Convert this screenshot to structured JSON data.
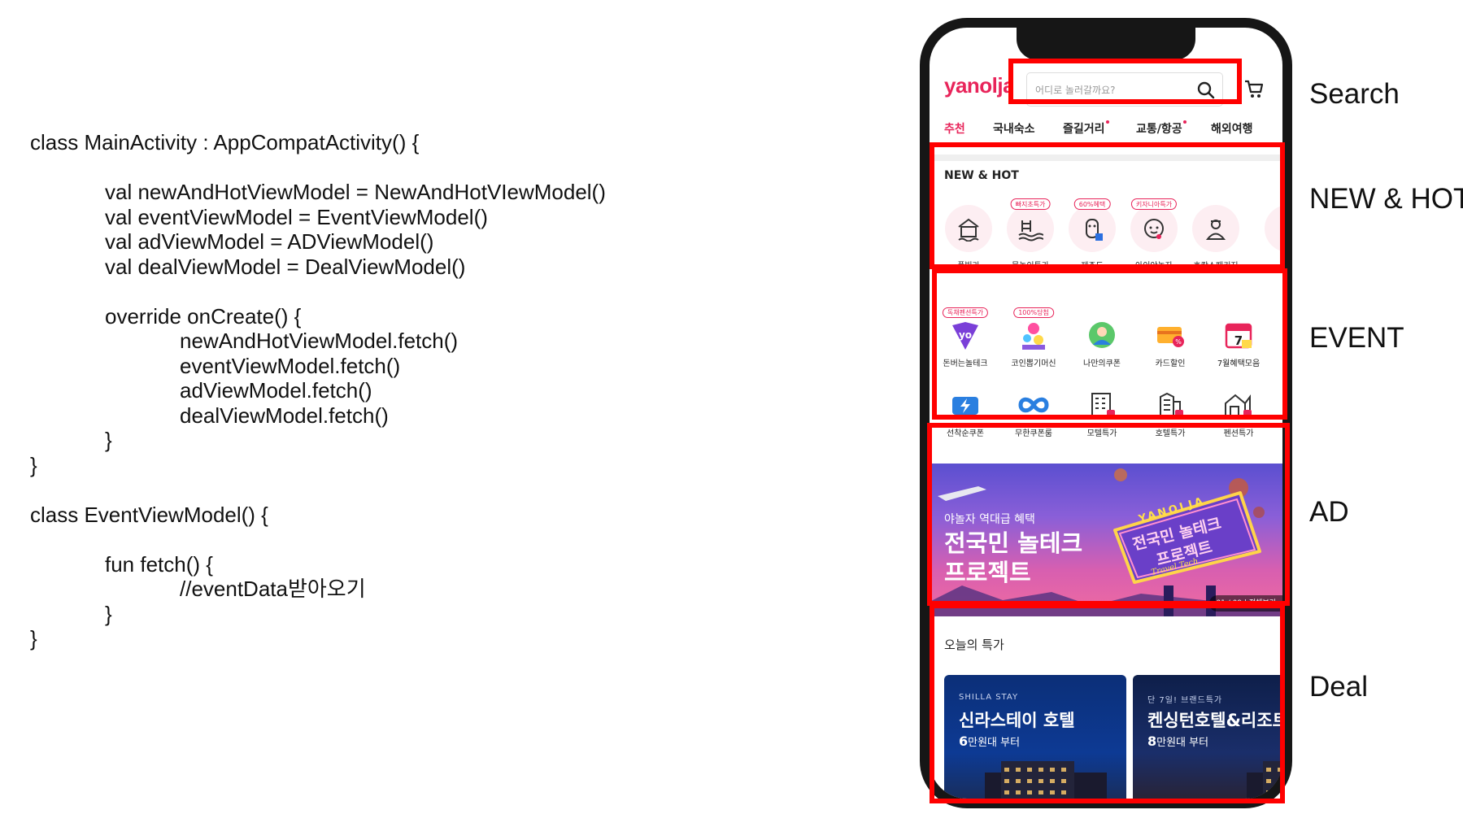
{
  "code_lines": [
    {
      "text": "class MainActivity : AppCompatActivity() {",
      "indent": 0,
      "row": 0
    },
    {
      "text": "val newAndHotViewModel = NewAndHotVIewModel()",
      "indent": 1,
      "row": 2
    },
    {
      "text": "val eventViewModel = EventViewModel()",
      "indent": 1,
      "row": 3
    },
    {
      "text": "val adViewModel = ADViewModel()",
      "indent": 1,
      "row": 4
    },
    {
      "text": "val dealViewModel = DealViewModel()",
      "indent": 1,
      "row": 5
    },
    {
      "text": "override onCreate() {",
      "indent": 1,
      "row": 7
    },
    {
      "text": "newAndHotViewModel.fetch()",
      "indent": 2,
      "row": 8
    },
    {
      "text": "eventViewModel.fetch()",
      "indent": 2,
      "row": 9
    },
    {
      "text": "adViewModel.fetch()",
      "indent": 2,
      "row": 10
    },
    {
      "text": "dealViewModel.fetch()",
      "indent": 2,
      "row": 11
    },
    {
      "text": "}",
      "indent": 1,
      "row": 12
    },
    {
      "text": "}",
      "indent": 0,
      "row": 13
    },
    {
      "text": "class EventViewModel() {",
      "indent": 0,
      "row": 15
    },
    {
      "text": "fun fetch() {",
      "indent": 1,
      "row": 17
    },
    {
      "text": "//eventData받아오기",
      "indent": 2,
      "row": 18
    },
    {
      "text": "}",
      "indent": 1,
      "row": 19
    },
    {
      "text": "}",
      "indent": 0,
      "row": 20
    }
  ],
  "app": {
    "logo": "yanolja",
    "search_placeholder": "어디로 놀러갈까요?",
    "search_icon": "search-icon",
    "cart_icon": "cart-icon",
    "accent": "#e8245a",
    "tabs": [
      {
        "label": "추천",
        "active": true,
        "dot": false
      },
      {
        "label": "국내숙소",
        "active": false,
        "dot": false
      },
      {
        "label": "즐길거리",
        "active": false,
        "dot": true
      },
      {
        "label": "교통/항공",
        "active": false,
        "dot": true
      },
      {
        "label": "해외여행",
        "active": false,
        "dot": false
      }
    ]
  },
  "new_hot": {
    "title": "NEW & HOT",
    "items": [
      {
        "label": "풀빌라",
        "badge": "",
        "icon": "pool-villa-icon"
      },
      {
        "label": "물놀이특가",
        "badge": "빠지초특가",
        "icon": "water-play-icon"
      },
      {
        "label": "제주도",
        "badge": "60%혜택",
        "icon": "jeju-icon"
      },
      {
        "label": "아이야놀자",
        "badge": "키자니아특가",
        "icon": "kid-icon"
      },
      {
        "label": "호캉스패키지",
        "badge": "",
        "icon": "hotel-staff-icon"
      }
    ]
  },
  "event": {
    "row1": [
      {
        "label": "돈버는놀테크",
        "badge": "독채펜션특가",
        "icon": "yo-coin-icon"
      },
      {
        "label": "코인뽑기머신",
        "badge": "100%당첨",
        "icon": "claw-machine-icon"
      },
      {
        "label": "나만의쿠폰",
        "badge": "",
        "icon": "my-coupon-icon"
      },
      {
        "label": "카드할인",
        "badge": "",
        "icon": "card-discount-icon"
      },
      {
        "label": "7월혜택모음",
        "badge": "",
        "icon": "calendar-icon"
      }
    ],
    "row2": [
      {
        "label": "선착순쿠폰",
        "badge": "",
        "icon": "flash-coupon-icon"
      },
      {
        "label": "무한쿠폰룸",
        "badge": "",
        "icon": "infinity-icon"
      },
      {
        "label": "모텔특가",
        "badge": "",
        "icon": "motel-icon"
      },
      {
        "label": "호텔특가",
        "badge": "",
        "icon": "hotel-icon"
      },
      {
        "label": "펜션특가",
        "badge": "",
        "icon": "pension-icon"
      }
    ]
  },
  "ad": {
    "subtitle": "야놀자 역대급 혜택",
    "title_line1": "전국민 놀테크",
    "title_line2": "프로젝트",
    "sign_top": "YANOLJA",
    "sign_line1": "전국민 놀테크",
    "sign_line2": "프로젝트",
    "sign_script": "Travel Tech",
    "counter": "01 / 09 | 전체보기"
  },
  "deal": {
    "title": "오늘의 특가",
    "cards": [
      {
        "brand": "SHILLA STAY",
        "name": "신라스테이 호텔",
        "price_big": "6",
        "price_rest": "만원대 부터"
      },
      {
        "brand": "단 7일! 브랜드특가",
        "name": "켄싱턴호텔&리조트",
        "price_big": "8",
        "price_rest": "만원대 부터"
      }
    ]
  },
  "labels": {
    "search": "Search",
    "new_hot": "NEW & HOT",
    "event": "EVENT",
    "ad": "AD",
    "deal": "Deal"
  },
  "highlight_color": "#ff0000"
}
